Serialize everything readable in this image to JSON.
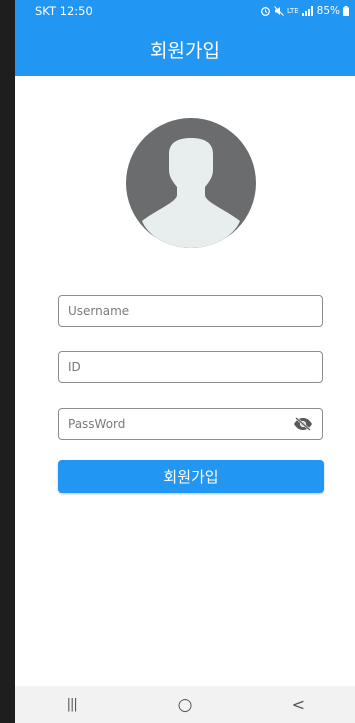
{
  "status_bar": {
    "carrier_time": "SKT 12:50",
    "network": "LTE",
    "battery": "85%"
  },
  "app_bar": {
    "title": "회원가입"
  },
  "avatar": {
    "icon": "person-silhouette-icon"
  },
  "form": {
    "username_placeholder": "Username",
    "id_placeholder": "ID",
    "password_placeholder": "PassWord",
    "password_toggle_icon": "eye-off-icon",
    "submit_label": "회원가입"
  },
  "nav_bar": {
    "recents": "|||",
    "home": "○",
    "back": "<"
  },
  "colors": {
    "primary": "#2196f3",
    "avatar_bg": "#6a6c6e",
    "silhouette": "#e8eded"
  }
}
